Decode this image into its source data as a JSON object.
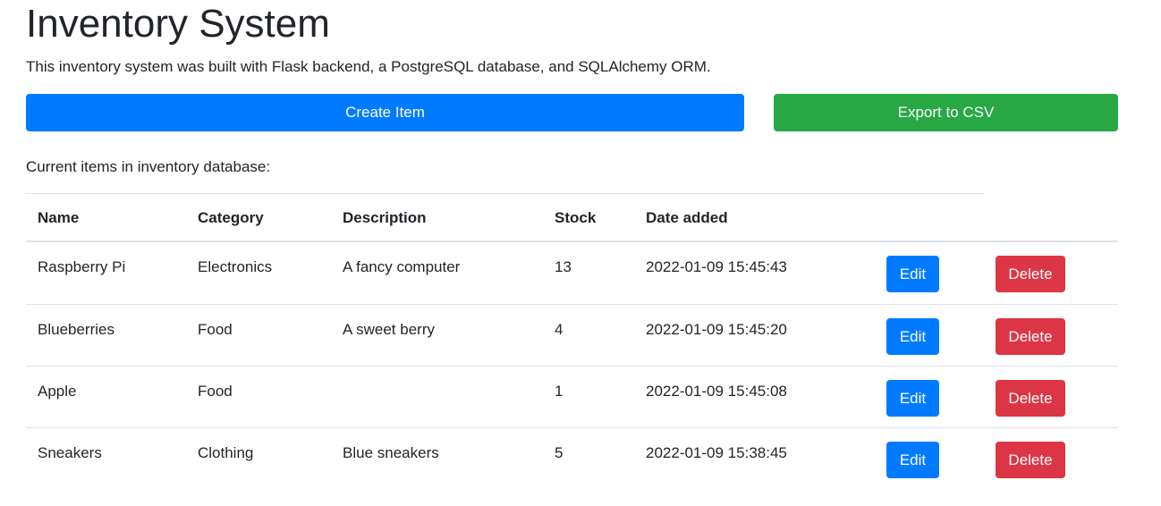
{
  "header": {
    "title": "Inventory System",
    "subtitle": "This inventory system was built with Flask backend, a PostgreSQL database, and SQLAlchemy ORM."
  },
  "actions": {
    "create_label": "Create Item",
    "export_label": "Export to CSV"
  },
  "table": {
    "caption": "Current items in inventory database:",
    "columns": [
      "Name",
      "Category",
      "Description",
      "Stock",
      "Date added"
    ],
    "rows": [
      {
        "name": "Raspberry Pi",
        "category": "Electronics",
        "description": "A fancy computer",
        "stock": "13",
        "date_added": "2022-01-09 15:45:43",
        "edit_label": "Edit",
        "delete_label": "Delete"
      },
      {
        "name": "Blueberries",
        "category": "Food",
        "description": "A sweet berry",
        "stock": "4",
        "date_added": "2022-01-09 15:45:20",
        "edit_label": "Edit",
        "delete_label": "Delete"
      },
      {
        "name": "Apple",
        "category": "Food",
        "description": "",
        "stock": "1",
        "date_added": "2022-01-09 15:45:08",
        "edit_label": "Edit",
        "delete_label": "Delete"
      },
      {
        "name": "Sneakers",
        "category": "Clothing",
        "description": "Blue sneakers",
        "stock": "5",
        "date_added": "2022-01-09 15:38:45",
        "edit_label": "Edit",
        "delete_label": "Delete"
      }
    ]
  },
  "colors": {
    "primary": "#007bff",
    "success": "#28a745",
    "danger": "#dc3545",
    "text": "#212529",
    "border": "#dee2e6"
  }
}
